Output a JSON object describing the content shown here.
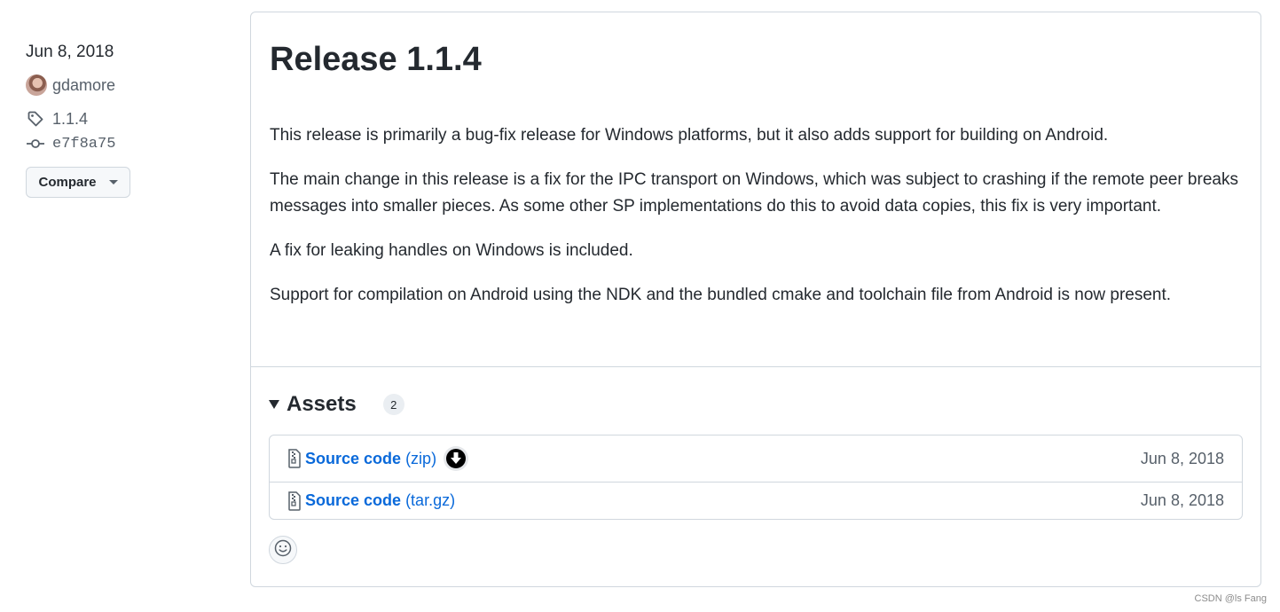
{
  "sidebar": {
    "date": "Jun 8, 2018",
    "author": "gdamore",
    "tag": "1.1.4",
    "commit": "e7f8a75",
    "compare_label": "Compare"
  },
  "release": {
    "title": "Release 1.1.4",
    "paragraphs": [
      "This release is primarily a bug-fix release for Windows platforms, but it also adds support for building on Android.",
      "The main change in this release is a fix for the IPC transport on Windows, which was subject to crashing if the remote peer breaks messages into smaller pieces. As some other SP implementations do this to avoid data copies, this fix is very important.",
      "A fix for leaking handles on Windows is included.",
      "Support for compilation on Android using the NDK and the bundled cmake and toolchain file from Android is now present."
    ]
  },
  "assets": {
    "title": "Assets",
    "count": "2",
    "items": [
      {
        "name": "Source code",
        "ext": "(zip)",
        "date": "Jun 8, 2018"
      },
      {
        "name": "Source code",
        "ext": "(tar.gz)",
        "date": "Jun 8, 2018"
      }
    ]
  },
  "watermark": "CSDN @ls Fang",
  "colors": {
    "link": "#0969da",
    "border": "#d0d7de",
    "muted": "#57606a",
    "text": "#24292f"
  },
  "icons": [
    "tag-icon",
    "commit-icon",
    "caret-down-icon",
    "triangle-down-icon",
    "file-zip-icon",
    "download-icon",
    "smiley-icon"
  ]
}
